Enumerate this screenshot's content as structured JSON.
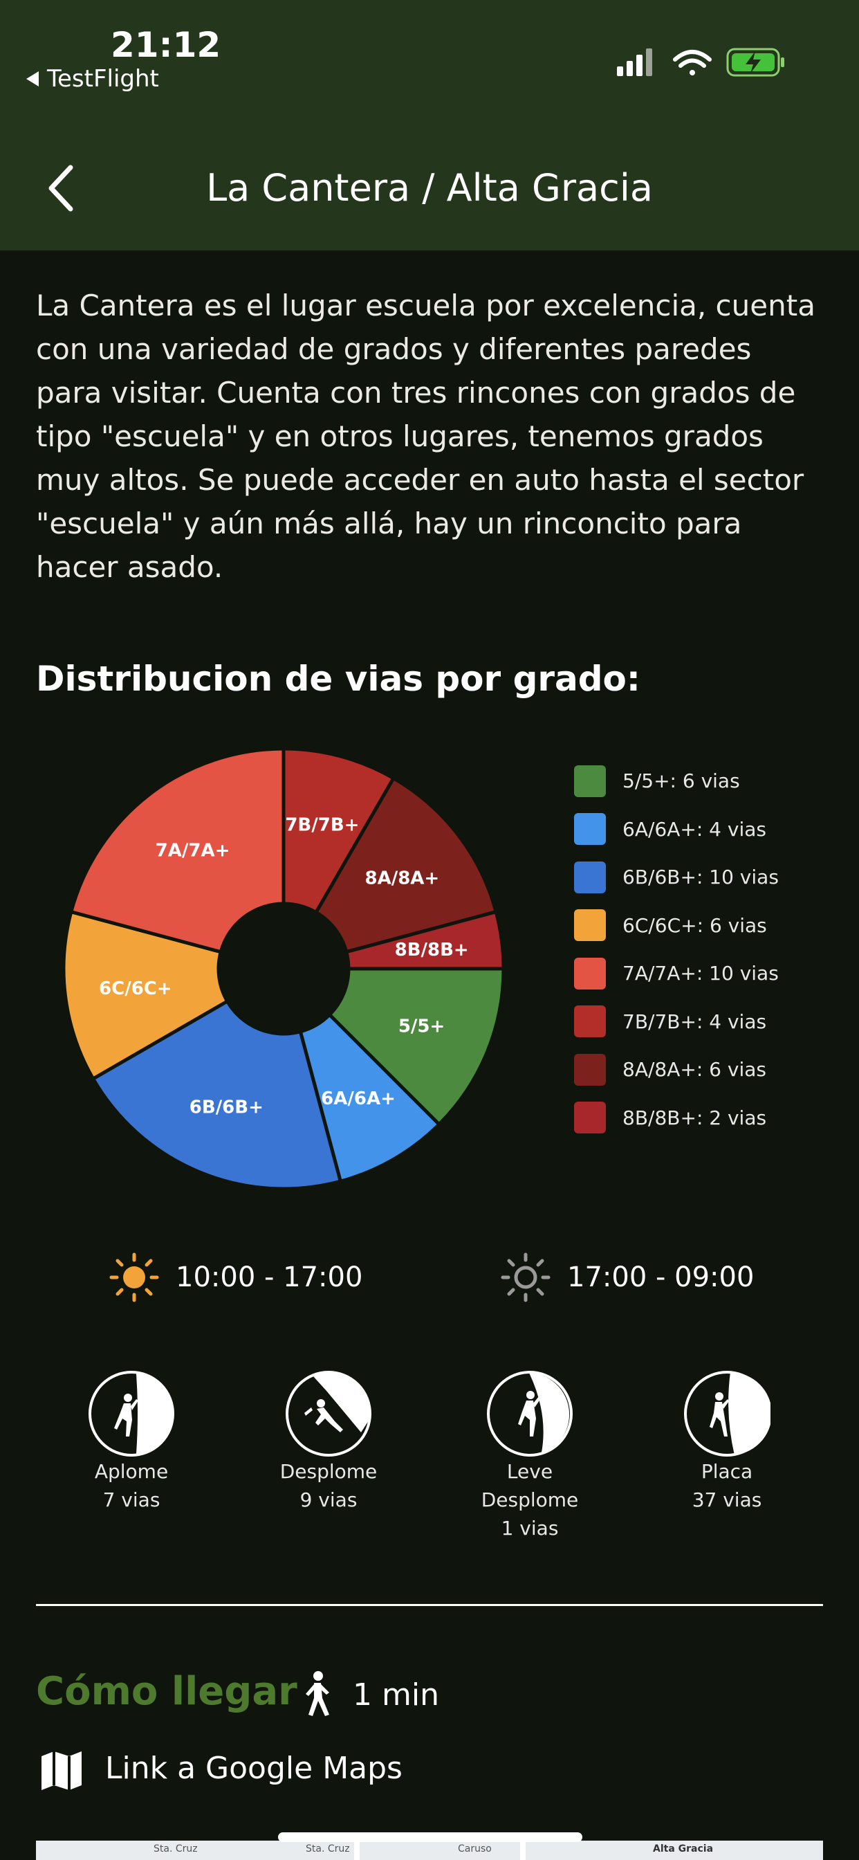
{
  "status_bar": {
    "time": "21:12",
    "back_app": "TestFlight"
  },
  "nav": {
    "title": "La Cantera / Alta Gracia"
  },
  "description": "La Cantera es el lugar escuela por excelencia, cuenta con una variedad de grados y diferentes paredes para visitar. Cuenta con tres rincones con grados de tipo \"escuela\" y en otros lugares, tenemos grados muy altos. Se puede acceder en auto hasta el sector \"escuela\" y aún más allá, hay un rinconcito para hacer asado.",
  "chart_title": "Distribucion de vias por grado:",
  "chart_data": {
    "type": "pie",
    "categories": [
      "5/5+",
      "6A/6A+",
      "6B/6B+",
      "6C/6C+",
      "7A/7A+",
      "7B/7B+",
      "8A/8A+",
      "8B/8B+"
    ],
    "values": [
      6,
      4,
      10,
      6,
      10,
      4,
      6,
      2
    ],
    "colors": [
      "#4c8a3f",
      "#4493ea",
      "#3b75d3",
      "#f2a33a",
      "#e35444",
      "#b32e28",
      "#7c211c",
      "#a8272a"
    ],
    "legend": [
      "5/5+: 6 vias",
      "6A/6A+: 4 vias",
      "6B/6B+: 10 vias",
      "6C/6C+: 6 vias",
      "7A/7A+: 10 vias",
      "7B/7B+: 4 vias",
      "8A/8A+: 6 vias",
      "8B/8B+: 2 vias"
    ],
    "legend_placement": "right",
    "donut": true
  },
  "sun": {
    "sun_hours": "10:00 - 17:00",
    "shade_hours": "17:00 - 09:00",
    "sun_color": "#f2a33a",
    "shade_color": "#9a9a9a"
  },
  "styles": [
    {
      "name": "Aplome",
      "count": "7 vias",
      "icon": "climber-vertical-icon"
    },
    {
      "name": "Desplome",
      "count": "9 vias",
      "icon": "climber-overhang-icon"
    },
    {
      "name": "Leve\nDesplome",
      "count": "1 vias",
      "icon": "climber-slight-overhang-icon"
    },
    {
      "name": "Placa",
      "count": "37 vias",
      "icon": "climber-slab-icon"
    }
  ],
  "how_to_get": {
    "title": "Cómo llegar",
    "walk_time": "1 min",
    "maps_link": "Link a Google Maps",
    "accent": "#4e7a2e"
  },
  "map": {
    "labels": [
      "Sta. Cruz",
      "Sta. Cruz",
      "Caruso",
      "Alta Gracia"
    ]
  }
}
